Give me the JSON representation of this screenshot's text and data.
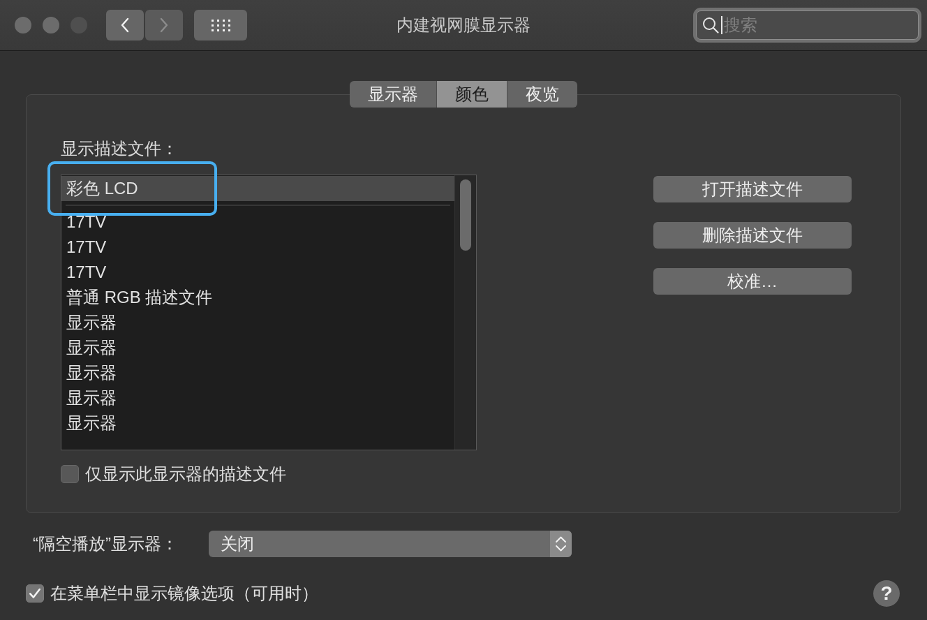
{
  "window": {
    "title": "内建视网膜显示器"
  },
  "navigation": [
    {
      "kind": "back",
      "disabled": false
    },
    {
      "kind": "forward",
      "disabled": true
    }
  ],
  "search": {
    "placeholder": "搜索",
    "focused": true
  },
  "tabs": [
    {
      "label": "显示器",
      "selected": false
    },
    {
      "label": "颜色",
      "selected": true
    },
    {
      "label": "夜览",
      "selected": false
    }
  ],
  "profiles": {
    "label": "显示描述文件：",
    "items": [
      {
        "kind": "profile",
        "name": "彩色 LCD",
        "selected": true,
        "circled": true
      },
      {
        "kind": "separator"
      },
      {
        "kind": "profile",
        "name": "17TV",
        "selected": false,
        "circled": false
      },
      {
        "kind": "profile",
        "name": "17TV",
        "selected": false,
        "circled": false
      },
      {
        "kind": "profile",
        "name": "17TV",
        "selected": false,
        "circled": false
      },
      {
        "kind": "profile",
        "name": "普通 RGB 描述文件",
        "selected": false,
        "circled": false
      },
      {
        "kind": "profile",
        "name": "显示器",
        "selected": false,
        "circled": false
      },
      {
        "kind": "profile",
        "name": "显示器",
        "selected": false,
        "circled": false
      },
      {
        "kind": "profile",
        "name": "显示器",
        "selected": false,
        "circled": false
      },
      {
        "kind": "profile",
        "name": "显示器",
        "selected": false,
        "circled": false
      },
      {
        "kind": "profile",
        "name": "显示器",
        "selected": false,
        "circled": false
      }
    ]
  },
  "buttons": [
    "打开描述文件",
    "删除描述文件",
    "校准…"
  ],
  "only_this_display": {
    "label": "仅显示此显示器的描述文件",
    "checked": false
  },
  "airplay_display": {
    "label": "“隔空播放”显示器：",
    "value": "关闭"
  },
  "show_mirroring_options": {
    "label": "在菜单栏中显示镜像选项（可用时）",
    "checked": true
  },
  "help_button": {
    "label": "?"
  }
}
